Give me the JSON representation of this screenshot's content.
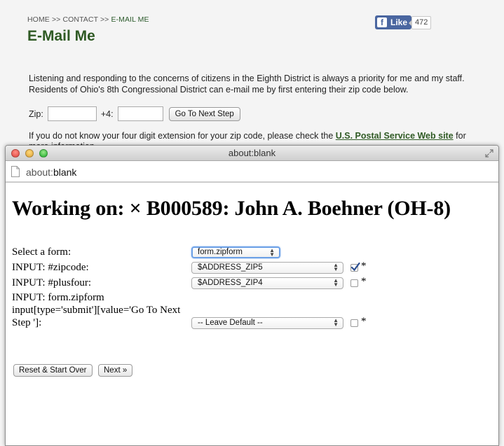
{
  "background_page": {
    "breadcrumb": {
      "home": "HOME",
      "sep1": ">>",
      "contact": "CONTACT",
      "sep2": ">>",
      "current": "E-MAIL ME"
    },
    "title": "E-Mail Me",
    "fb_like": {
      "label": "Like",
      "count": "472"
    },
    "intro_text": "Listening and responding to the concerns of citizens in the Eighth District is always a priority for me and my staff.  Residents of Ohio's 8th Congressional District can e-mail me by first entering their zip code below.",
    "zip_label": "Zip:",
    "plus4_label": "+4:",
    "next_button": "Go To Next Step",
    "extension_note_prefix": "If you do not know your four digit extension for your zip code, please check the ",
    "extension_link": "U.S. Postal Service Web site",
    "extension_note_suffix": " for",
    "more_info": "more information."
  },
  "window": {
    "title": "about:blank",
    "url_scheme": "about:",
    "url_host": "blank"
  },
  "form": {
    "heading": "Working on: × B000589: John A. Boehner (OH-8)",
    "rows": [
      {
        "label": "Select a form:",
        "select_value": "form.zipform",
        "has_checkbox": false
      },
      {
        "label": "INPUT: #zipcode:",
        "select_value": "$ADDRESS_ZIP5",
        "checked": true,
        "star": "*"
      },
      {
        "label": "INPUT: #plusfour:",
        "select_value": "$ADDRESS_ZIP4",
        "checked": false,
        "star": "*"
      },
      {
        "label": "INPUT: form.zipform input[type='submit'][value='Go To Next Step ']:",
        "select_value": "-- Leave Default --",
        "checked": false,
        "star": "*"
      }
    ],
    "reset_button": "Reset & Start Over",
    "next_button": "Next »"
  },
  "colors": {
    "title_green": "#2f5a24",
    "fb_blue": "#4a66a0",
    "focus_ring": "#6ca0e6",
    "checkbox_check": "#2a4d8f"
  }
}
